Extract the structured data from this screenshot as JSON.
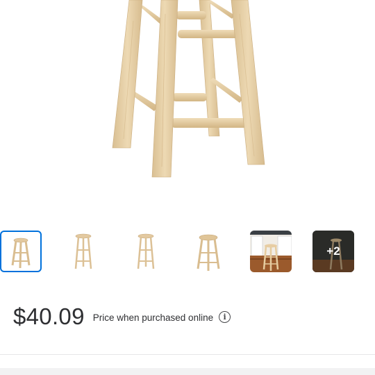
{
  "product": {
    "image_alt": "Wooden bar stool"
  },
  "gallery": {
    "thumbnails": [
      {
        "name": "thumbnail-1",
        "selected": true
      },
      {
        "name": "thumbnail-2",
        "selected": false
      },
      {
        "name": "thumbnail-3",
        "selected": false
      },
      {
        "name": "thumbnail-4",
        "selected": false
      },
      {
        "name": "thumbnail-5",
        "selected": false
      },
      {
        "name": "thumbnail-6",
        "selected": false
      }
    ],
    "more_label": "+2"
  },
  "pricing": {
    "price": "$40.09",
    "note": "Price when purchased online",
    "info_icon": "info-icon"
  },
  "colors": {
    "accent": "#0071dc",
    "wood": "#e6cfa5",
    "text": "#2e2f32"
  }
}
